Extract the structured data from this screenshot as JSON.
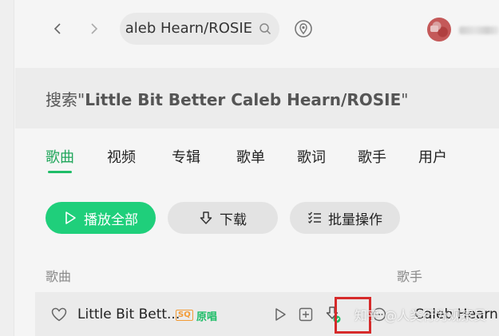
{
  "search": {
    "query_visible": "aleb Hearn/ROSIE"
  },
  "header": {
    "prefix": "搜索\"",
    "query": "Little Bit Better Caleb Hearn/ROSIE",
    "suffix": "\""
  },
  "tabs": [
    {
      "label": "歌曲",
      "active": true
    },
    {
      "label": "视频",
      "active": false
    },
    {
      "label": "专辑",
      "active": false
    },
    {
      "label": "歌单",
      "active": false
    },
    {
      "label": "歌词",
      "active": false
    },
    {
      "label": "歌手",
      "active": false
    },
    {
      "label": "用户",
      "active": false
    }
  ],
  "actions": {
    "play_all": "播放全部",
    "download": "下载",
    "batch": "批量操作"
  },
  "list": {
    "col_song": "歌曲",
    "col_singer": "歌手",
    "rows": [
      {
        "title": "Little Bit Bett...",
        "quality_badge": "SQ",
        "original_badge": "原唱",
        "singer": "Caleb Hearn"
      }
    ]
  },
  "watermark": "知乎 @人类行为观察员",
  "colors": {
    "accent": "#1fcf7b",
    "highlight": "#d62a2a",
    "sq_badge": "#f29b36"
  }
}
